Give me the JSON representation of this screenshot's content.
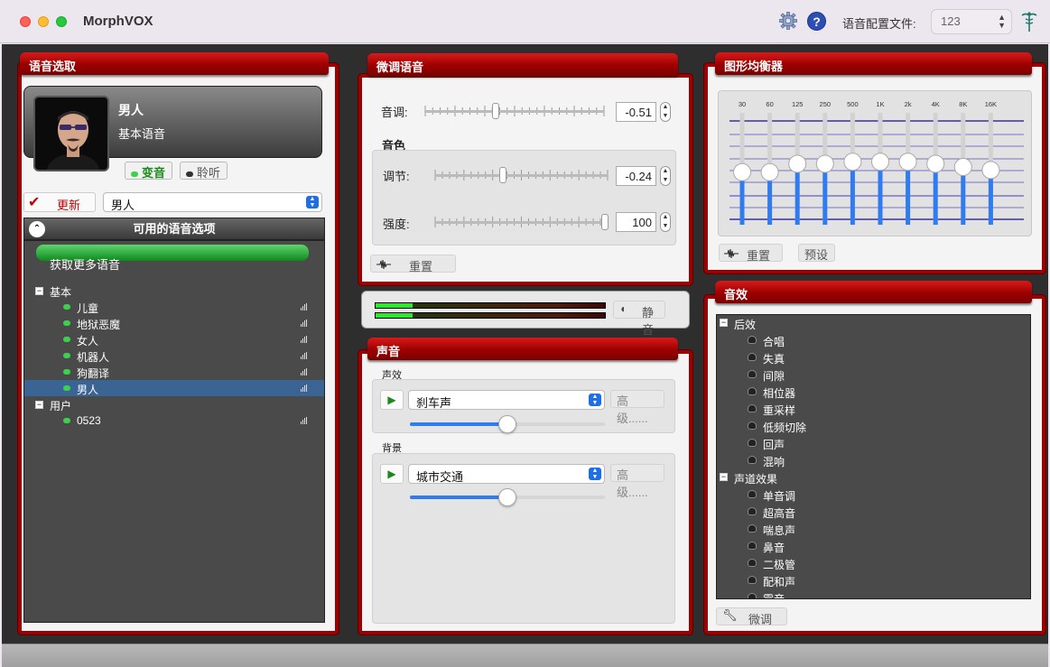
{
  "app": {
    "title": "MorphVOX",
    "profile_label": "语音配置文件:",
    "profile_value": "123"
  },
  "voice_select": {
    "tab": "语音选取",
    "name": "男人",
    "subtitle": "基本语音",
    "morph_label": "变音",
    "listen_label": "聆听",
    "update_label": "更新",
    "selected_voice": "男人",
    "list_header": "可用的语音选项",
    "get_more": "获取更多语音",
    "groups": [
      {
        "label": "基本",
        "items": [
          "儿童",
          "地狱恶魔",
          "女人",
          "机器人",
          "狗翻译",
          "男人"
        ]
      },
      {
        "label": "用户",
        "items": [
          "0523"
        ]
      }
    ],
    "selected_index": 5
  },
  "tweak": {
    "tab": "微调语音",
    "pitch_label": "音调:",
    "pitch_value": "-0.51",
    "pitch_position": 0.39,
    "timbre_label": "音色",
    "adjust_label": "调节:",
    "adjust_value": "-0.24",
    "adjust_position": 0.39,
    "strength_label": "强度:",
    "strength_value": "100",
    "strength_position": 1.0,
    "reset_label": "重置"
  },
  "meter": {
    "mute_label": "静音",
    "level_top": 0.16,
    "level_bottom": 0.16
  },
  "sound": {
    "tab": "声音",
    "effect_label": "声效",
    "effect_value": "刹车声",
    "effect_volume": 0.5,
    "advanced_label": "高级......",
    "background_label": "背景",
    "background_value": "城市交通",
    "background_volume": 0.5,
    "advanced_label_2": "高级......"
  },
  "eq": {
    "tab": "图形均衡器",
    "bands": [
      "30",
      "60",
      "125",
      "250",
      "500",
      "1K",
      "2k",
      "4K",
      "8K",
      "16K"
    ],
    "levels": [
      0.42,
      0.42,
      0.5,
      0.5,
      0.52,
      0.52,
      0.52,
      0.5,
      0.47,
      0.44
    ],
    "reset_label": "重置",
    "preset_label": "预设"
  },
  "effects": {
    "tab": "音效",
    "groups": [
      {
        "label": "后效",
        "items": [
          "合唱",
          "失真",
          "间隙",
          "相位器",
          "重采样",
          "低频切除",
          "回声",
          "混响"
        ]
      },
      {
        "label": "声道效果",
        "items": [
          "单音调",
          "超高音",
          "喘息声",
          "鼻音",
          "二极管",
          "配和声",
          "震音"
        ]
      }
    ],
    "tweak_label": "微调"
  },
  "colors": {
    "accent": "#9c0000",
    "panel_bg": "#f4f4f4",
    "list_bg": "#4a4a4a",
    "slider_blue": "#2f7cf0"
  },
  "icons": {
    "settings": "gear-icon",
    "help": "question-icon",
    "app_logo": "caduceus-icon"
  }
}
